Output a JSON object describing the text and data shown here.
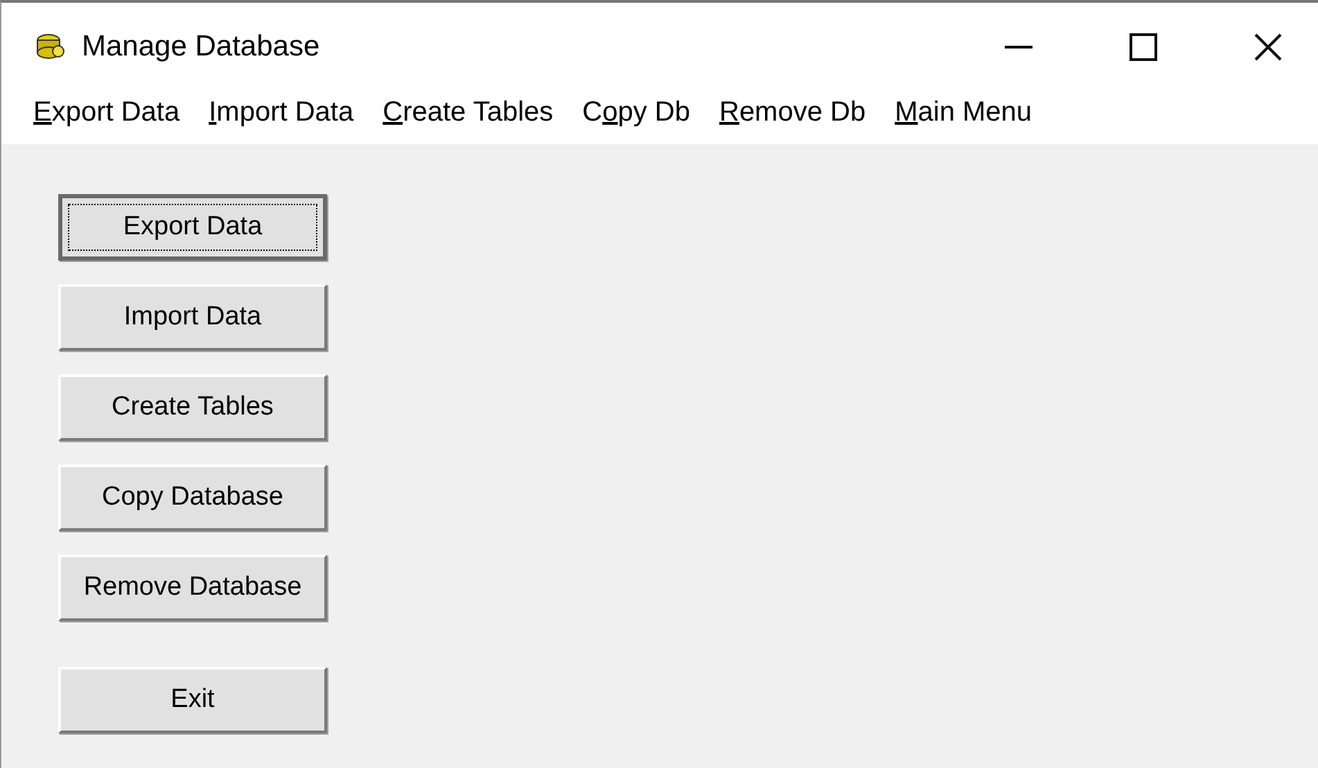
{
  "window": {
    "title": "Manage Database"
  },
  "menu": [
    {
      "key": "E",
      "after": "xport Data"
    },
    {
      "key": "I",
      "after": "mport Data"
    },
    {
      "key": "C",
      "after": "reate Tables"
    },
    {
      "before": "C",
      "key": "o",
      "after": "py Db"
    },
    {
      "key": "R",
      "after": "emove Db"
    },
    {
      "key": "M",
      "after": "ain Menu"
    }
  ],
  "buttons": [
    {
      "label": "Export Data",
      "focused": true,
      "kind": "action"
    },
    {
      "label": "Import Data",
      "focused": false,
      "kind": "action"
    },
    {
      "label": "Create Tables",
      "focused": false,
      "kind": "action"
    },
    {
      "label": "Copy Database",
      "focused": false,
      "kind": "action"
    },
    {
      "label": "Remove Database",
      "focused": false,
      "kind": "action"
    },
    {
      "label": "Exit",
      "focused": false,
      "kind": "exit"
    }
  ]
}
